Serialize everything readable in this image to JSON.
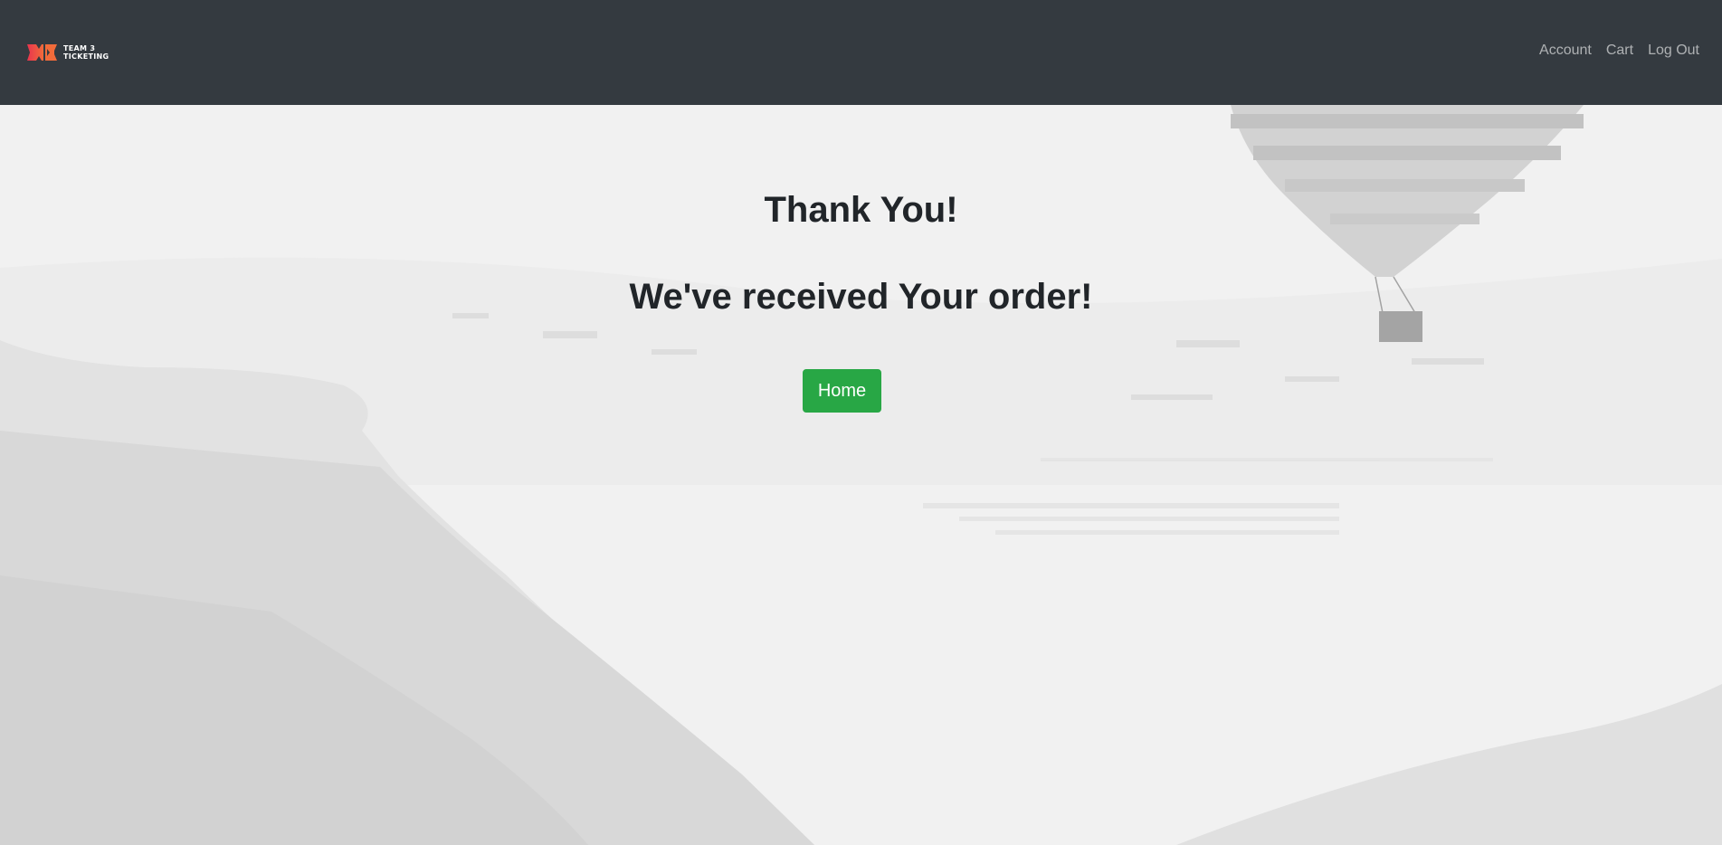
{
  "navbar": {
    "brand": {
      "line1": "TEAM 3",
      "line2": "TICKETING",
      "logo_icon": "ticket-logo-icon",
      "logo_colors": [
        "#e8344e",
        "#f26b3a"
      ]
    },
    "links": {
      "account": "Account",
      "cart": "Cart",
      "logout": "Log Out"
    },
    "background_color": "#343a40"
  },
  "main": {
    "title": "Thank You!",
    "subtitle": "We've received Your order!",
    "home_button_label": "Home",
    "home_button_color": "#28a745"
  }
}
